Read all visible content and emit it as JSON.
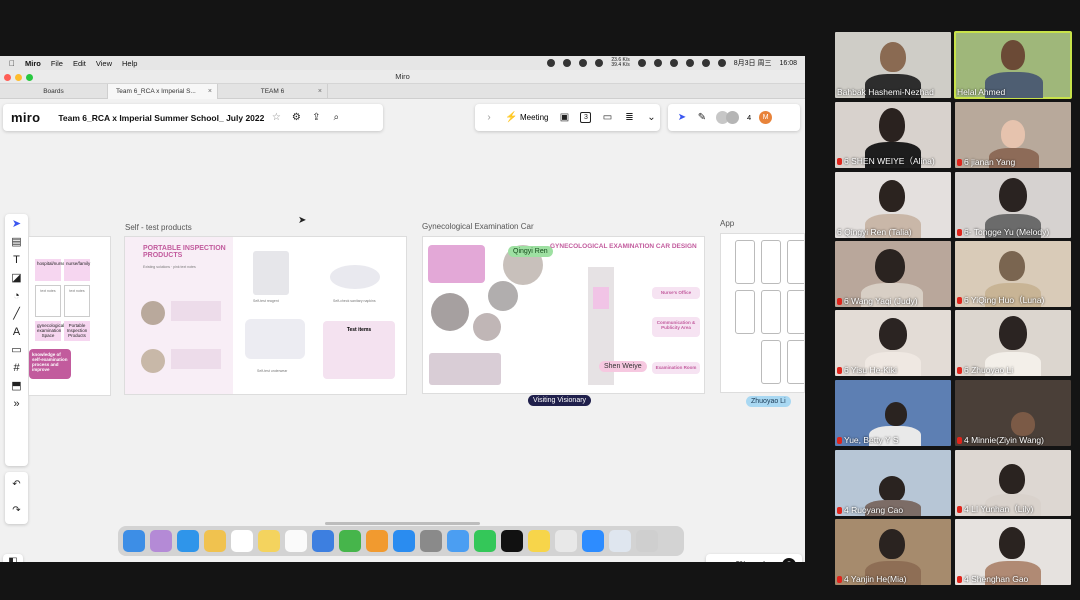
{
  "menubar": {
    "app": "Miro",
    "items": [
      "File",
      "Edit",
      "View",
      "Help"
    ],
    "net_up": "23.6 K/s",
    "net_down": "39.4 K/s",
    "date": "8月3日 周三",
    "time": "16:08"
  },
  "window": {
    "title": "Miro"
  },
  "tabs": [
    {
      "label": "Boards"
    },
    {
      "label": "Team 6_RCA x Imperial S..."
    },
    {
      "label": "TEAM 6"
    }
  ],
  "board": {
    "logo": "miro",
    "title": "Team 6_RCA x Imperial Summer School_ July 2022",
    "meeting_label": "Meeting",
    "timer_count": "3",
    "collaborator_count": "4",
    "user_initial": "M",
    "zoom": "5%",
    "help": "?"
  },
  "frames": {
    "left": {
      "sticky1": "hospital/nurse",
      "sticky2": "nurse/family",
      "sticky3": "gynecological examination Space",
      "sticky4": "Portable Inspection Products",
      "note": "knowledge of self-examination process and improve"
    },
    "self_test": {
      "label": "Self - test products",
      "title": "PORTABLE INSPECTION PRODUCTS",
      "item1": "Self-test reagent",
      "item2": "Self-check sanitary napkins",
      "item3": "Self-test underwear",
      "test_items_title": "Test items"
    },
    "gyn_car": {
      "label": "Gynecological Examination Car",
      "title": "GYNECOLOGICAL EXAMINATION CAR DESIGN",
      "office": "Nurse's Office",
      "comm": "Communication & Publicity Area",
      "exam": "Examination Room",
      "cursor_name": "Shen Weiye"
    },
    "app": {
      "label": "App"
    }
  },
  "cursors": {
    "qingyi": "Qingyi Ren",
    "visiting": "Visiting Visionary",
    "zhuoyao": "Zhuoyao Li"
  },
  "participants": [
    {
      "name": "Bahbak Hashemi-Nezhad",
      "muted": false
    },
    {
      "name": "Helal Ahmed",
      "muted": false
    },
    {
      "name": "6 SHEN WEIYE（Alina)",
      "muted": true
    },
    {
      "name": "6 jianan Yang",
      "muted": true
    },
    {
      "name": "6 Qingyi Ren (Talia)",
      "muted": false
    },
    {
      "name": "6- Tongge Yu (Melody)",
      "muted": true
    },
    {
      "name": "6 Wang Yaqi (Judy)",
      "muted": true
    },
    {
      "name": "6 YiQing Huo（Luna)",
      "muted": true
    },
    {
      "name": "6 Yisu He-Kiki",
      "muted": true
    },
    {
      "name": "6 Zhuoyao Li",
      "muted": true
    },
    {
      "name": "Yue, Betty Y S",
      "muted": true
    },
    {
      "name": "4 Minnie(Ziyin Wang)",
      "muted": true
    },
    {
      "name": "4 Ruoyang Cao",
      "muted": true
    },
    {
      "name": "4  LI Yunhan（Lily)",
      "muted": true
    },
    {
      "name": "4  Yanjin He(Mia)",
      "muted": true
    },
    {
      "name": "4 Shenghan Gao",
      "muted": true
    }
  ]
}
